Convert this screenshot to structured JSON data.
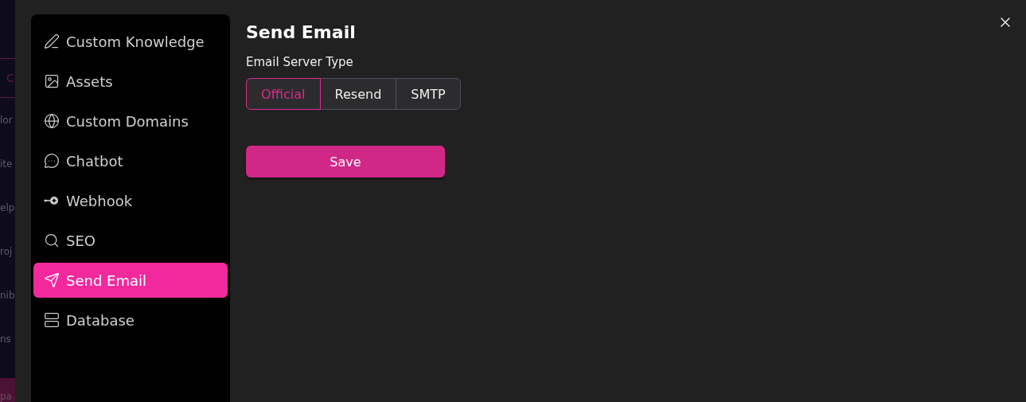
{
  "background_page": {
    "tab": "C",
    "items": [
      "lor",
      "ite",
      "elp",
      "roj",
      "nib",
      "ns"
    ],
    "footer": "pa"
  },
  "sidebar": {
    "items": [
      {
        "kind": "knowledge",
        "label": "Custom Knowledge",
        "selected": false
      },
      {
        "kind": "assets",
        "label": "Assets",
        "selected": false
      },
      {
        "kind": "domains",
        "label": "Custom Domains",
        "selected": false
      },
      {
        "kind": "chatbot",
        "label": "Chatbot",
        "selected": false
      },
      {
        "kind": "webhook",
        "label": "Webhook",
        "selected": false
      },
      {
        "kind": "seo",
        "label": "SEO",
        "selected": false
      },
      {
        "kind": "email",
        "label": "Send Email",
        "selected": true
      },
      {
        "kind": "database",
        "label": "Database",
        "selected": false
      }
    ]
  },
  "content": {
    "title": "Send Email",
    "field_label": "Email Server Type",
    "server_types": [
      {
        "label": "Official",
        "selected": true
      },
      {
        "label": "Resend",
        "selected": false
      },
      {
        "label": "SMTP",
        "selected": false
      }
    ],
    "save_button": "Save"
  }
}
